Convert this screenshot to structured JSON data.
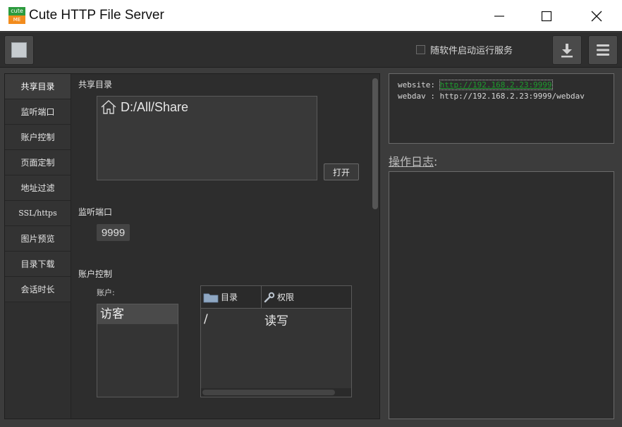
{
  "window": {
    "title": "Cute HTTP File Server",
    "logo_top": "cute",
    "logo_bottom": "ME",
    "controls": [
      "minimize",
      "maximize",
      "close"
    ]
  },
  "toolbar": {
    "autostart_label": "随软件启动运行服务",
    "autostart_checked": false
  },
  "nav": {
    "items": [
      "共享目录",
      "监听端口",
      "账户控制",
      "页面定制",
      "地址过滤",
      "SSL/https",
      "图片预览",
      "目录下载",
      "会话时长"
    ],
    "active": "共享目录"
  },
  "share": {
    "section_label": "共享目录",
    "path": "D:/All/Share",
    "open_label": "打开"
  },
  "port": {
    "section_label": "监听端口",
    "value": "9999"
  },
  "accounts": {
    "section_label": "账户控制",
    "users_label": "账户:",
    "users": [
      "访客"
    ],
    "table_headers": [
      "目录",
      "权限"
    ],
    "rows": [
      {
        "dir": "/",
        "perm": "读写"
      }
    ]
  },
  "info": {
    "website_label": "website:",
    "website_url": "http://192.168.2.23:9999",
    "webdav_label": "webdav :",
    "webdav_url": "http://192.168.2.23:9999/webdav"
  },
  "log": {
    "label_main": "操作日志",
    "label_colon": ":"
  },
  "colors": {
    "background": "#3c3c3c",
    "link": "#1f9a2f",
    "logo_green": "#2c9b3e",
    "logo_orange": "#f28c1e"
  }
}
